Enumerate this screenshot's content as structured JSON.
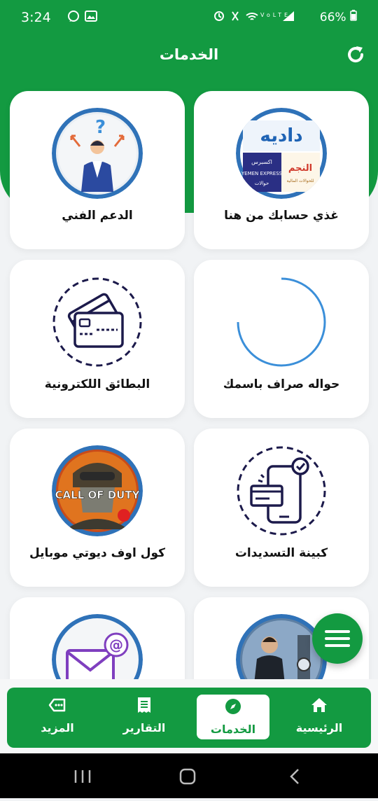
{
  "status_bar": {
    "time": "3:24",
    "battery": "66%"
  },
  "app_bar": {
    "title": "الخدمات"
  },
  "services": [
    {
      "label": "الدعم الفني"
    },
    {
      "label": "غذي حسابك من هنا",
      "logo_texts": [
        "داديه",
        "اكسبرس",
        "YEMEN EXPRESS",
        "حوالات",
        "النجم",
        "للحوالات المالية"
      ]
    },
    {
      "label": "البطائق اللكترونية"
    },
    {
      "label": "حواله صراف باسمك"
    },
    {
      "label": "كول اوف ديوتي موبايل",
      "logo_text": "CALL OF DUTY"
    },
    {
      "label": "كبينة التسديدات"
    },
    {
      "label": ""
    },
    {
      "label": ""
    }
  ],
  "bottom_nav": {
    "items": [
      {
        "label": "المزيد",
        "icon": "more-tag-icon"
      },
      {
        "label": "التقارير",
        "icon": "report-icon"
      },
      {
        "label": "الخدمات",
        "icon": "compass-icon",
        "active": true
      },
      {
        "label": "الرئيسية",
        "icon": "home-icon"
      }
    ]
  },
  "colors": {
    "primary": "#139a41",
    "accent_ring": "#2f72b8",
    "spinner": "#3b8fd9",
    "icon_dark": "#1c1a4b"
  }
}
